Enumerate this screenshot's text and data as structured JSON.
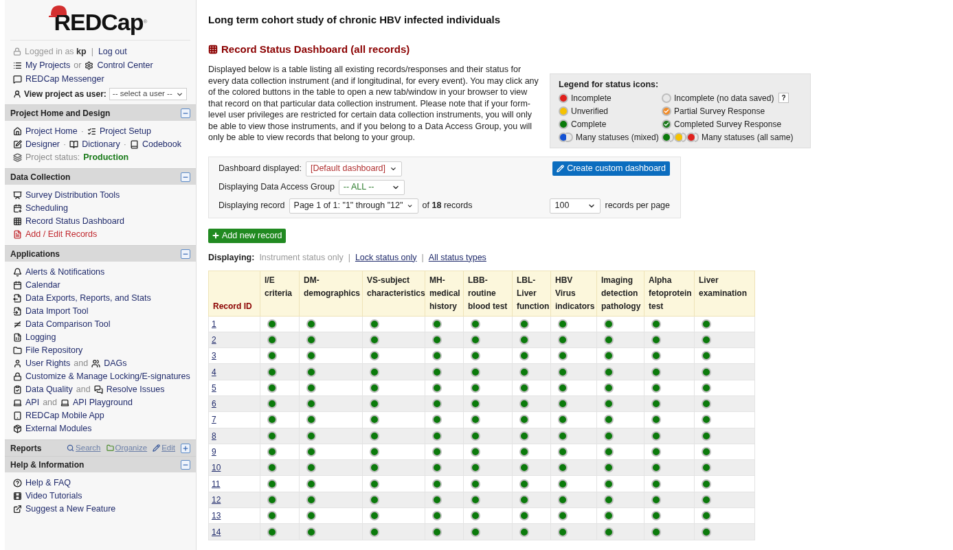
{
  "sidebar": {
    "logo": "REDCap",
    "logo_mark": "®",
    "login": {
      "prefix": "Logged in as",
      "user": "kp",
      "separator": "|",
      "logout": "Log out"
    },
    "top_lines": [
      [
        {
          "kind": "link",
          "text": "My Projects"
        },
        {
          "kind": "muted",
          "text": "or"
        },
        {
          "kind": "link",
          "text": "Control Center"
        }
      ],
      [
        {
          "kind": "link",
          "text": "REDCap Messenger"
        }
      ]
    ],
    "view_as": {
      "label": "View project as user:",
      "value": "-- select a user --"
    },
    "sections": [
      {
        "title": "Project Home and Design",
        "expanded": true,
        "lines": [
          [
            {
              "kind": "link",
              "text": "Project Home"
            },
            {
              "kind": "muted",
              "text": "·"
            },
            {
              "kind": "link",
              "text": "Project Setup"
            }
          ],
          [
            {
              "kind": "link",
              "text": "Designer"
            },
            {
              "kind": "muted",
              "text": "·"
            },
            {
              "kind": "link",
              "text": "Dictionary"
            },
            {
              "kind": "muted",
              "text": "·"
            },
            {
              "kind": "link",
              "text": "Codebook"
            }
          ],
          [
            {
              "kind": "muted",
              "text": "Project status:"
            },
            {
              "kind": "status",
              "text": "Production"
            }
          ]
        ]
      },
      {
        "title": "Data Collection",
        "expanded": true,
        "lines": [
          [
            {
              "kind": "link",
              "text": "Survey Distribution Tools"
            }
          ],
          [
            {
              "kind": "link",
              "text": "Scheduling"
            }
          ],
          [
            {
              "kind": "link",
              "text": "Record Status Dashboard"
            }
          ],
          [
            {
              "kind": "accent",
              "text": "Add / Edit Records"
            }
          ]
        ]
      },
      {
        "title": "Applications",
        "expanded": true,
        "lines": [
          [
            {
              "kind": "link",
              "text": "Alerts & Notifications"
            }
          ],
          [
            {
              "kind": "link",
              "text": "Calendar"
            }
          ],
          [
            {
              "kind": "link",
              "text": "Data Exports, Reports, and Stats"
            }
          ],
          [
            {
              "kind": "link",
              "text": "Data Import Tool"
            }
          ],
          [
            {
              "kind": "link",
              "text": "Data Comparison Tool"
            }
          ],
          [
            {
              "kind": "link",
              "text": "Logging"
            }
          ],
          [
            {
              "kind": "link",
              "text": "File Repository"
            }
          ],
          [
            {
              "kind": "link",
              "text": "User Rights"
            },
            {
              "kind": "muted",
              "text": "and"
            },
            {
              "kind": "link",
              "text": "DAGs"
            }
          ],
          [
            {
              "kind": "link",
              "text": "Customize & Manage Locking/E-signatures"
            }
          ],
          [
            {
              "kind": "link",
              "text": "Data Quality"
            },
            {
              "kind": "muted",
              "text": "and"
            },
            {
              "kind": "link",
              "text": "Resolve Issues"
            }
          ],
          [
            {
              "kind": "link",
              "text": "API"
            },
            {
              "kind": "muted",
              "text": "and"
            },
            {
              "kind": "link",
              "text": "API Playground"
            }
          ],
          [
            {
              "kind": "link",
              "text": "REDCap Mobile App"
            }
          ],
          [
            {
              "kind": "link",
              "text": "External Modules"
            }
          ]
        ]
      },
      {
        "title": "Reports",
        "expanded": false,
        "actions": [
          "Search",
          "Organize",
          "Edit"
        ]
      },
      {
        "title": "Help & Information",
        "expanded": true,
        "lines": [
          [
            {
              "kind": "link",
              "text": "Help & FAQ"
            }
          ],
          [
            {
              "kind": "link",
              "text": "Video Tutorials"
            }
          ],
          [
            {
              "kind": "link",
              "text": "Suggest a New Feature"
            }
          ]
        ]
      }
    ]
  },
  "project_title": "Long term cohort study of chronic HBV infected individuals",
  "page_heading": "Record Status Dashboard (all records)",
  "description": "Displayed below is a table listing all existing records/responses and their status for every data collection instrument (and if longitudinal, for every event). You may click any of the colored buttons in the table to open a new tab/window in your browser to view that record on that particular data collection instrument. Please note that if your form-level user privileges are restricted for certain data collection instruments, you will only be able to view those instruments, and if you belong to a Data Access Group, you will only be able to view records that belong to your group.",
  "legend": {
    "title": "Legend for status icons:",
    "help": "?",
    "items": [
      {
        "kind": "incomplete",
        "label": "Incomplete"
      },
      {
        "kind": "nodata",
        "label": "Incomplete (no data saved)"
      },
      {
        "kind": "unverified",
        "label": "Unverified"
      },
      {
        "kind": "partial",
        "label": "Partial Survey Response"
      },
      {
        "kind": "complete",
        "label": "Complete"
      },
      {
        "kind": "completed_survey",
        "label": "Completed Survey Response"
      },
      {
        "kind": "mixed",
        "label": "Many statuses (mixed)"
      },
      {
        "kind": "allsame",
        "label": "Many statuses (all same)"
      }
    ]
  },
  "filters": {
    "dashboard": {
      "label": "Dashboard displayed:",
      "value": "[Default dashboard]"
    },
    "create_button": "Create custom dashboard",
    "dag": {
      "label": "Displaying Data Access Group",
      "value": "-- ALL --"
    },
    "record": {
      "label": "Displaying record",
      "value": "Page 1 of 1: \"1\" through \"12\"",
      "of": "of",
      "count": "18",
      "suffix": "records"
    },
    "per_page": {
      "value": "100",
      "label": "records per page"
    }
  },
  "add_button": "Add new record",
  "display_mode": {
    "label": "Displaying:",
    "separators": [
      "|",
      "|"
    ],
    "options": [
      {
        "label": "Instrument status only",
        "selected": true
      },
      {
        "label": "Lock status only",
        "selected": false
      },
      {
        "label": "All status types",
        "selected": false
      }
    ]
  },
  "table": {
    "columns": [
      "Record ID",
      "I/E criteria",
      "DM-demographics",
      "VS-subject characteristics",
      "MH-medical history",
      "LBB-routine blood test",
      "LBL-Liver function",
      "HBV Virus indicators",
      "Imaging detection pathology",
      "Alpha fetoprotein test",
      "Liver examination"
    ],
    "rows": [
      {
        "record": "1",
        "cells": [
          {
            "kind": "complete"
          },
          {
            "kind": "complete"
          },
          {
            "kind": "complete"
          },
          {
            "kind": "complete"
          },
          {
            "kind": "complete"
          },
          {
            "kind": "complete"
          },
          {
            "kind": "complete"
          },
          {
            "kind": "complete"
          },
          {
            "kind": "complete"
          },
          {
            "kind": "complete"
          }
        ]
      },
      {
        "record": "2",
        "cells": [
          {
            "kind": "complete"
          },
          {
            "kind": "complete"
          },
          {
            "kind": "complete"
          },
          {
            "kind": "complete"
          },
          {
            "kind": "complete"
          },
          {
            "kind": "complete"
          },
          {
            "kind": "complete"
          },
          {
            "kind": "complete"
          },
          {
            "kind": "complete"
          },
          {
            "kind": "complete"
          }
        ]
      },
      {
        "record": "3",
        "cells": [
          {
            "kind": "complete"
          },
          {
            "kind": "complete"
          },
          {
            "kind": "complete"
          },
          {
            "kind": "complete"
          },
          {
            "kind": "complete"
          },
          {
            "kind": "complete"
          },
          {
            "kind": "complete"
          },
          {
            "kind": "complete"
          },
          {
            "kind": "complete"
          },
          {
            "kind": "complete"
          }
        ]
      },
      {
        "record": "4",
        "cells": [
          {
            "kind": "complete"
          },
          {
            "kind": "complete"
          },
          {
            "kind": "complete"
          },
          {
            "kind": "complete"
          },
          {
            "kind": "complete"
          },
          {
            "kind": "complete"
          },
          {
            "kind": "complete"
          },
          {
            "kind": "complete"
          },
          {
            "kind": "complete"
          },
          {
            "kind": "complete"
          }
        ]
      },
      {
        "record": "5",
        "cells": [
          {
            "kind": "complete"
          },
          {
            "kind": "complete"
          },
          {
            "kind": "complete"
          },
          {
            "kind": "complete"
          },
          {
            "kind": "complete"
          },
          {
            "kind": "complete"
          },
          {
            "kind": "complete"
          },
          {
            "kind": "complete"
          },
          {
            "kind": "complete"
          },
          {
            "kind": "complete"
          }
        ]
      },
      {
        "record": "6",
        "cells": [
          {
            "kind": "complete"
          },
          {
            "kind": "complete"
          },
          {
            "kind": "complete"
          },
          {
            "kind": "complete"
          },
          {
            "kind": "complete"
          },
          {
            "kind": "complete"
          },
          {
            "kind": "complete"
          },
          {
            "kind": "complete"
          },
          {
            "kind": "complete"
          },
          {
            "kind": "complete"
          }
        ]
      },
      {
        "record": "7",
        "cells": [
          {
            "kind": "complete"
          },
          {
            "kind": "complete"
          },
          {
            "kind": "complete"
          },
          {
            "kind": "complete"
          },
          {
            "kind": "complete"
          },
          {
            "kind": "complete"
          },
          {
            "kind": "complete"
          },
          {
            "kind": "complete"
          },
          {
            "kind": "complete"
          },
          {
            "kind": "complete"
          }
        ]
      },
      {
        "record": "8",
        "cells": [
          {
            "kind": "complete"
          },
          {
            "kind": "complete"
          },
          {
            "kind": "complete"
          },
          {
            "kind": "complete"
          },
          {
            "kind": "complete"
          },
          {
            "kind": "complete"
          },
          {
            "kind": "complete"
          },
          {
            "kind": "complete"
          },
          {
            "kind": "complete"
          },
          {
            "kind": "complete"
          }
        ]
      },
      {
        "record": "9",
        "cells": [
          {
            "kind": "complete"
          },
          {
            "kind": "complete"
          },
          {
            "kind": "complete"
          },
          {
            "kind": "complete"
          },
          {
            "kind": "complete"
          },
          {
            "kind": "complete"
          },
          {
            "kind": "complete"
          },
          {
            "kind": "complete"
          },
          {
            "kind": "complete"
          },
          {
            "kind": "complete"
          }
        ]
      },
      {
        "record": "10",
        "cells": [
          {
            "kind": "complete"
          },
          {
            "kind": "complete"
          },
          {
            "kind": "complete"
          },
          {
            "kind": "complete"
          },
          {
            "kind": "complete"
          },
          {
            "kind": "complete"
          },
          {
            "kind": "complete"
          },
          {
            "kind": "complete"
          },
          {
            "kind": "complete"
          },
          {
            "kind": "complete"
          }
        ]
      },
      {
        "record": "11",
        "cells": [
          {
            "kind": "complete"
          },
          {
            "kind": "complete"
          },
          {
            "kind": "complete"
          },
          {
            "kind": "complete"
          },
          {
            "kind": "complete"
          },
          {
            "kind": "complete"
          },
          {
            "kind": "complete"
          },
          {
            "kind": "complete"
          },
          {
            "kind": "complete"
          },
          {
            "kind": "complete"
          }
        ]
      },
      {
        "record": "12",
        "cells": [
          {
            "kind": "complete"
          },
          {
            "kind": "complete"
          },
          {
            "kind": "complete"
          },
          {
            "kind": "complete"
          },
          {
            "kind": "complete"
          },
          {
            "kind": "complete"
          },
          {
            "kind": "complete"
          },
          {
            "kind": "complete"
          },
          {
            "kind": "complete"
          },
          {
            "kind": "complete"
          }
        ]
      },
      {
        "record": "13",
        "cells": [
          {
            "kind": "complete"
          },
          {
            "kind": "complete"
          },
          {
            "kind": "complete"
          },
          {
            "kind": "complete"
          },
          {
            "kind": "complete"
          },
          {
            "kind": "complete"
          },
          {
            "kind": "complete"
          },
          {
            "kind": "complete"
          },
          {
            "kind": "complete"
          },
          {
            "kind": "complete"
          }
        ]
      },
      {
        "record": "14",
        "cells": [
          {
            "kind": "complete"
          },
          {
            "kind": "complete"
          },
          {
            "kind": "complete"
          },
          {
            "kind": "complete"
          },
          {
            "kind": "complete"
          },
          {
            "kind": "complete"
          },
          {
            "kind": "complete"
          },
          {
            "kind": "complete"
          },
          {
            "kind": "complete"
          },
          {
            "kind": "complete"
          }
        ]
      }
    ]
  }
}
